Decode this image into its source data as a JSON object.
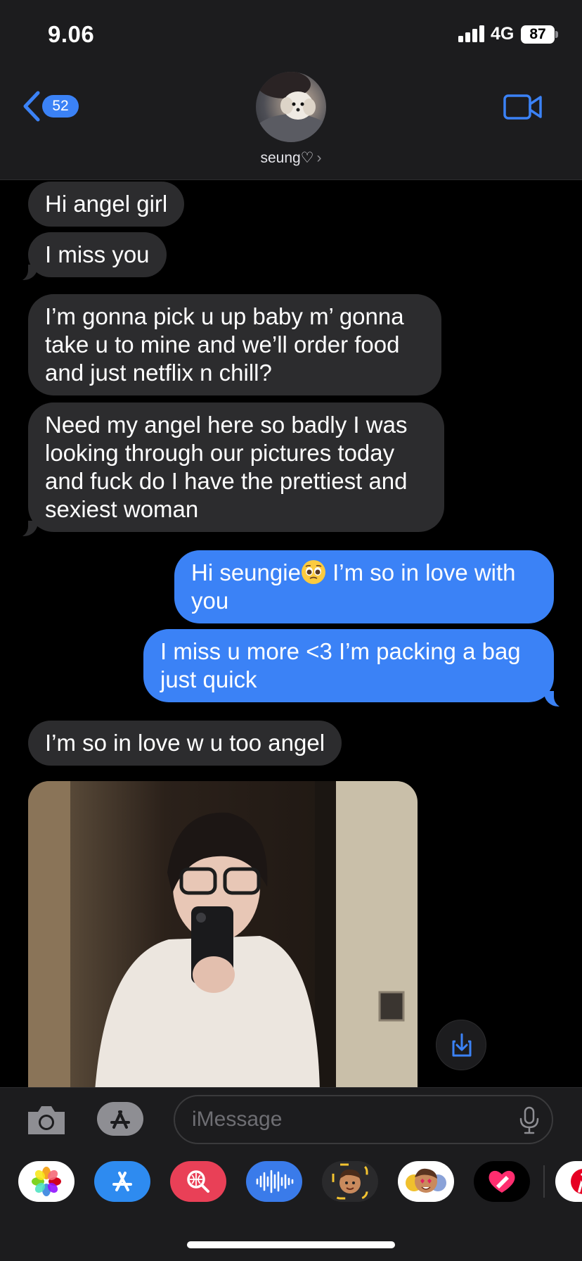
{
  "status_bar": {
    "time": "9.06",
    "network": "4G",
    "battery": "87"
  },
  "header": {
    "back_badge_count": "52",
    "contact_name": "seung♡",
    "contact_chevron": "›"
  },
  "messages": [
    {
      "direction": "incoming",
      "text": "Hi angel girl"
    },
    {
      "direction": "incoming",
      "text": "I miss you"
    },
    {
      "direction": "incoming",
      "text": "I’m gonna pick u up baby m’ gonna take u to mine and we’ll order food and just netflix n chill?"
    },
    {
      "direction": "incoming",
      "text": "Need my angel here so badly I was looking through our pictures today and fuck do I have the prettiest and sexiest woman"
    },
    {
      "direction": "outgoing",
      "text_before_emoji": "Hi seungie",
      "emoji": "pleading-face",
      "text_after_emoji": " I’m so in love with you"
    },
    {
      "direction": "outgoing",
      "text": "I miss u more <3 I’m packing a bag just quick"
    },
    {
      "direction": "incoming",
      "text": "I’m so in love w u too angel"
    },
    {
      "direction": "incoming",
      "type": "photo",
      "description_icon": "mirror-selfie-photo"
    }
  ],
  "input_bar": {
    "placeholder": "iMessage",
    "value": ""
  },
  "app_drawer": {
    "apps": [
      {
        "icon": "photos-icon"
      },
      {
        "icon": "app-store-icon"
      },
      {
        "icon": "web-images-search-icon"
      },
      {
        "icon": "audio-message-icon"
      },
      {
        "icon": "memoji-icon"
      },
      {
        "icon": "memoji-stickers-icon"
      },
      {
        "icon": "digital-touch-icon"
      },
      {
        "icon": "pinterest-icon"
      }
    ]
  },
  "colors": {
    "outgoing_bubble": "#3b82f6",
    "incoming_bubble": "#2c2c2e",
    "accent": "#3b82f6",
    "background": "#000000"
  }
}
